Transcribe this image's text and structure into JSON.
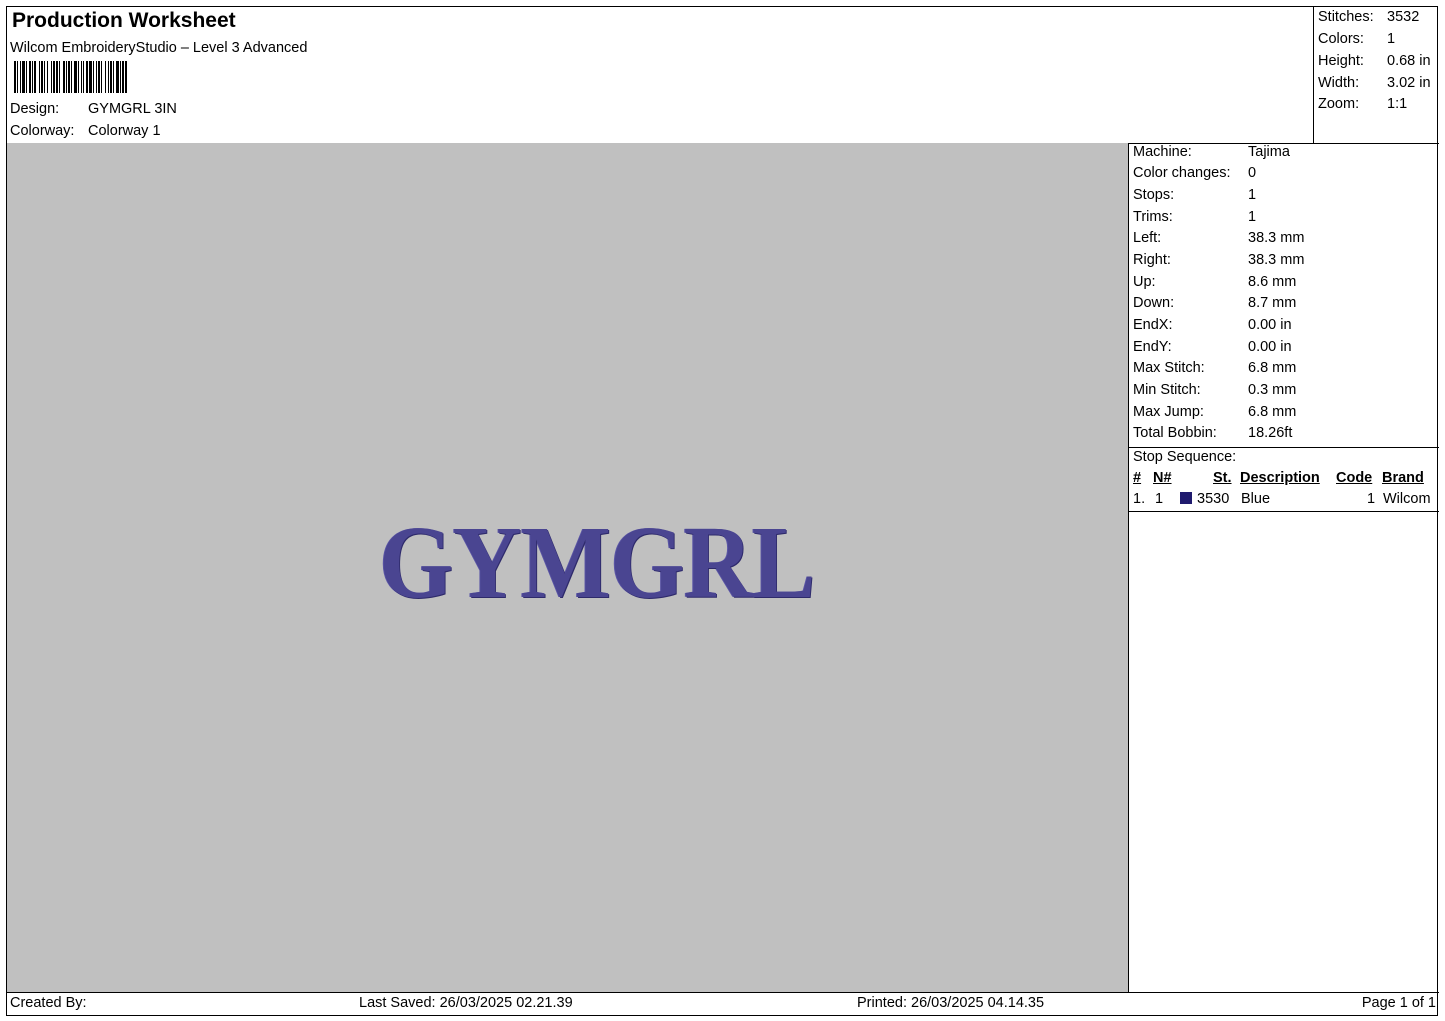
{
  "header": {
    "title": "Production Worksheet",
    "subtitle": "Wilcom EmbroideryStudio – Level 3 Advanced",
    "design_label": "Design:",
    "design_value": "GYMGRL 3IN",
    "colorway_label": "Colorway:",
    "colorway_value": "Colorway 1"
  },
  "top_stats": [
    {
      "label": "Stitches:",
      "value": "3532"
    },
    {
      "label": "Colors:",
      "value": "1"
    },
    {
      "label": "Height:",
      "value": "0.68 in"
    },
    {
      "label": "Width:",
      "value": "3.02 in"
    },
    {
      "label": "Zoom:",
      "value": "1:1"
    }
  ],
  "design": {
    "text": "GYMGRL",
    "thread_color": "#4a4591",
    "background_color": "#c0c0c0"
  },
  "machine_info": [
    {
      "label": "Machine:",
      "value": "Tajima"
    },
    {
      "label": "Color changes:",
      "value": "0"
    },
    {
      "label": "Stops:",
      "value": "1"
    },
    {
      "label": "Trims:",
      "value": "1"
    },
    {
      "label": "Left:",
      "value": "38.3 mm"
    },
    {
      "label": "Right:",
      "value": "38.3 mm"
    },
    {
      "label": "Up:",
      "value": "8.6 mm"
    },
    {
      "label": "Down:",
      "value": "8.7 mm"
    },
    {
      "label": "EndX:",
      "value": "0.00 in"
    },
    {
      "label": "EndY:",
      "value": "0.00 in"
    },
    {
      "label": "Max Stitch:",
      "value": "6.8 mm"
    },
    {
      "label": "Min Stitch:",
      "value": "0.3 mm"
    },
    {
      "label": "Max Jump:",
      "value": "6.8 mm"
    },
    {
      "label": "Total Bobbin:",
      "value": "18.26ft"
    }
  ],
  "stop_sequence": {
    "title": "Stop Sequence:",
    "headers": {
      "num": "#",
      "n": "N#",
      "st": "St.",
      "description": "Description",
      "code": "Code",
      "brand": "Brand"
    },
    "rows": [
      {
        "num": "1.",
        "n": "1",
        "swatch": "#1f1a6e",
        "st": "3530",
        "description": "Blue",
        "code": "1",
        "brand": "Wilcom"
      }
    ]
  },
  "footer": {
    "created_by": "Created By:",
    "last_saved": "Last Saved: 26/03/2025 02.21.39",
    "printed": "Printed: 26/03/2025 04.14.35",
    "page": "Page 1 of 1"
  }
}
